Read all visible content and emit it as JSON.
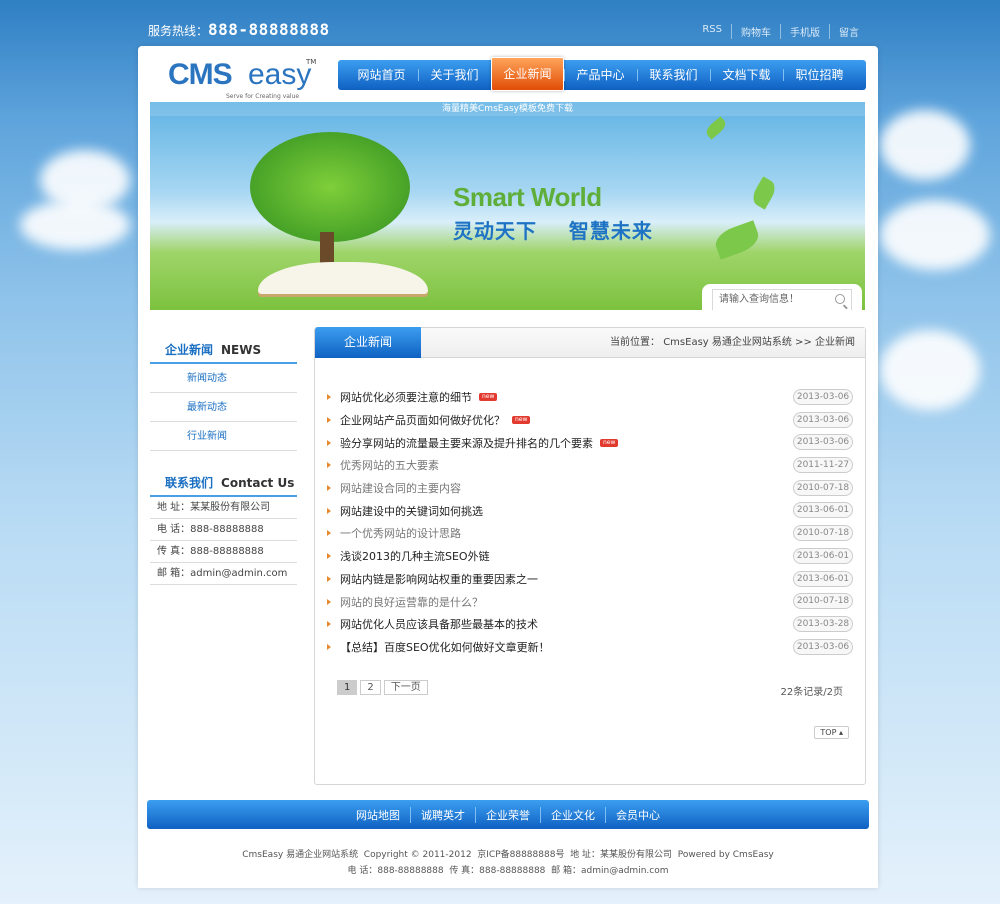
{
  "header": {
    "hotline_label": "服务热线：",
    "hotline_number": "888-88888888",
    "links": [
      "RSS",
      "购物车",
      "手机版",
      "留言"
    ]
  },
  "logo": {
    "brand_a": "CMS",
    "brand_b": "easy",
    "tm": "TM",
    "slogan": "Serve for Creating value"
  },
  "nav": {
    "items": [
      "网站首页",
      "关于我们",
      "企业新闻",
      "产品中心",
      "联系我们",
      "文档下载",
      "职位招聘"
    ],
    "active_index": 2
  },
  "banner": {
    "caption": "海量精美CmsEasy模板免费下载",
    "title_en": "Smart World",
    "title_cn": "灵动天下    智慧未来"
  },
  "search": {
    "placeholder": "请输入查询信息！"
  },
  "sidebar": {
    "news_title": "企业新闻",
    "news_en": "NEWS",
    "news_links": [
      "新闻动态",
      "最新动态",
      "行业新闻"
    ],
    "contact_title": "联系我们",
    "contact_en": "Contact Us",
    "contact": [
      "地 址：某某股份有限公司",
      "电 话：888-88888888",
      "传 真：888-88888888",
      "邮 箱：admin@admin.com"
    ]
  },
  "main": {
    "tab": "企业新闻",
    "breadcrumb": "当前位置：  CmsEasy 易通企业网站系统  >> 企业新闻",
    "new_badge": "new",
    "articles": [
      {
        "title": "网站优化必须要注意的细节",
        "date": "2013-03-06",
        "new": true,
        "grey": false
      },
      {
        "title": "企业网站产品页面如何做好优化？",
        "date": "2013-03-06",
        "new": true,
        "grey": false
      },
      {
        "title": "验分享网站的流量最主要来源及提升排名的几个要素",
        "date": "2013-03-06",
        "new": true,
        "grey": false
      },
      {
        "title": "优秀网站的五大要素",
        "date": "2011-11-27",
        "new": false,
        "grey": true
      },
      {
        "title": "网站建设合同的主要内容",
        "date": "2010-07-18",
        "new": false,
        "grey": true
      },
      {
        "title": "网站建设中的关键词如何挑选",
        "date": "2013-06-01",
        "new": false,
        "grey": false
      },
      {
        "title": "一个优秀网站的设计思路",
        "date": "2010-07-18",
        "new": false,
        "grey": true
      },
      {
        "title": "浅谈2013的几种主流SEO外链",
        "date": "2013-06-01",
        "new": false,
        "grey": false
      },
      {
        "title": "网站内链是影响网站权重的重要因素之一",
        "date": "2013-06-01",
        "new": false,
        "grey": false
      },
      {
        "title": "网站的良好运营靠的是什么？",
        "date": "2010-07-18",
        "new": false,
        "grey": true
      },
      {
        "title": "网站优化人员应该具备那些最基本的技术",
        "date": "2013-03-28",
        "new": false,
        "grey": false
      },
      {
        "title": "【总结】百度SEO优化如何做好文章更新！",
        "date": "2013-03-06",
        "new": false,
        "grey": false
      }
    ],
    "pager": [
      "1",
      "2",
      "下一页"
    ],
    "count": "22条记录/2页",
    "top": "TOP ▴"
  },
  "footer": {
    "links": [
      "网站地图",
      "诚聘英才",
      "企业荣誉",
      "企业文化",
      "会员中心"
    ],
    "line1": "CmsEasy 易通企业网站系统  Copyright © 2011-2012  京ICP备88888888号  地 址：某某股份有限公司  Powered by CmsEasy",
    "line2": "电 话：888-88888888  传 真：888-88888888  邮 箱：admin@admin.com"
  },
  "colors": {
    "accent_blue": "#1a6fc2",
    "active_orange": "#e14d07"
  }
}
